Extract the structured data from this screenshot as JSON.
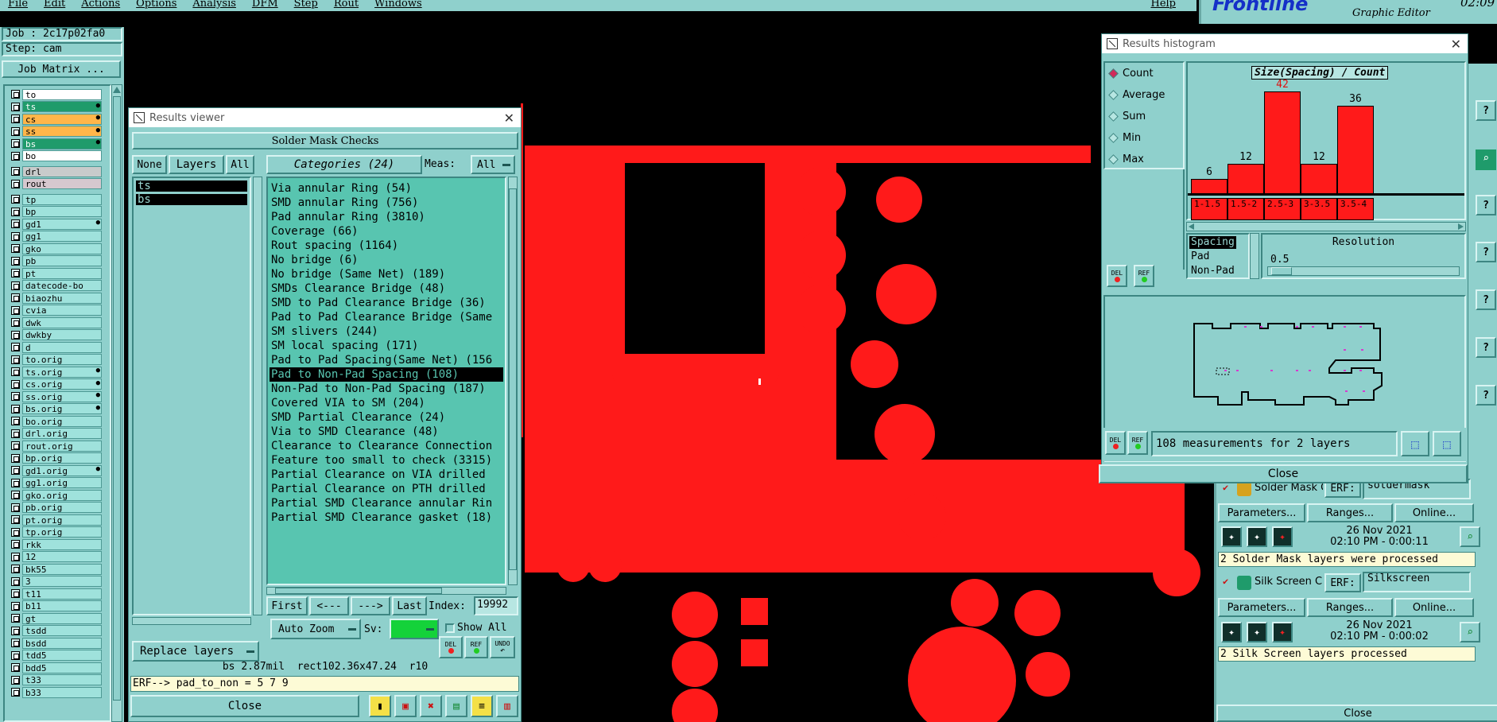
{
  "menu": {
    "items": [
      "File",
      "Edit",
      "Actions",
      "Options",
      "Analysis",
      "DFM",
      "Step",
      "Rout",
      "Windows"
    ],
    "help": "Help"
  },
  "brand": {
    "logo": "Frontline",
    "subtitle": "Graphic Editor",
    "clock": "02:09"
  },
  "job": {
    "job_label": "Job : 2c17p02fa0",
    "step_label": "Step: cam",
    "matrix_button": "Job Matrix ..."
  },
  "layers": [
    {
      "name": "to",
      "color": "#ffffff"
    },
    {
      "name": "ts",
      "color": "#1f9b6b"
    },
    {
      "name": "cs",
      "color": "#ffb64a"
    },
    {
      "name": "ss",
      "color": "#ffb64a"
    },
    {
      "name": "bs",
      "color": "#1f9b6b"
    },
    {
      "name": "bo",
      "color": "#ffffff"
    },
    {
      "name": "drl",
      "color": "#c8cbcb"
    },
    {
      "name": "rout",
      "color": "#d6c8cf"
    },
    {
      "name": "tp",
      "color": "#9fe2dc"
    },
    {
      "name": "bp",
      "color": "#9fe2dc"
    },
    {
      "name": "gd1",
      "color": "#9fe2dc"
    },
    {
      "name": "gg1",
      "color": "#9fe2dc"
    },
    {
      "name": "gko",
      "color": "#9fe2dc"
    },
    {
      "name": "pb",
      "color": "#9fe2dc"
    },
    {
      "name": "pt",
      "color": "#9fe2dc"
    },
    {
      "name": "datecode-bo",
      "color": "#9fe2dc"
    },
    {
      "name": "biaozhu",
      "color": "#9fe2dc"
    },
    {
      "name": "cvia",
      "color": "#9fe2dc"
    },
    {
      "name": "dwk",
      "color": "#9fe2dc"
    },
    {
      "name": "dwkby",
      "color": "#9fe2dc"
    },
    {
      "name": "d",
      "color": "#9fe2dc"
    },
    {
      "name": "to.orig",
      "color": "#9fe2dc"
    },
    {
      "name": "ts.orig",
      "color": "#9fe2dc"
    },
    {
      "name": "cs.orig",
      "color": "#9fe2dc"
    },
    {
      "name": "ss.orig",
      "color": "#9fe2dc"
    },
    {
      "name": "bs.orig",
      "color": "#9fe2dc"
    },
    {
      "name": "bo.orig",
      "color": "#9fe2dc"
    },
    {
      "name": "drl.orig",
      "color": "#9fe2dc"
    },
    {
      "name": "rout.orig",
      "color": "#9fe2dc"
    },
    {
      "name": "bp.orig",
      "color": "#9fe2dc"
    },
    {
      "name": "gd1.orig",
      "color": "#9fe2dc"
    },
    {
      "name": "gg1.orig",
      "color": "#9fe2dc"
    },
    {
      "name": "gko.orig",
      "color": "#9fe2dc"
    },
    {
      "name": "pb.orig",
      "color": "#9fe2dc"
    },
    {
      "name": "pt.orig",
      "color": "#9fe2dc"
    },
    {
      "name": "tp.orig",
      "color": "#9fe2dc"
    },
    {
      "name": "rkk",
      "color": "#9fe2dc"
    },
    {
      "name": "12",
      "color": "#9fe2dc"
    },
    {
      "name": "bk55",
      "color": "#9fe2dc"
    },
    {
      "name": "3",
      "color": "#9fe2dc"
    },
    {
      "name": "t11",
      "color": "#9fe2dc"
    },
    {
      "name": "b11",
      "color": "#9fe2dc"
    },
    {
      "name": "gt",
      "color": "#9fe2dc"
    },
    {
      "name": "tsdd",
      "color": "#9fe2dc"
    },
    {
      "name": "bsdd",
      "color": "#9fe2dc"
    },
    {
      "name": "tdd5",
      "color": "#9fe2dc"
    },
    {
      "name": "bdd5",
      "color": "#9fe2dc"
    },
    {
      "name": "t33",
      "color": "#9fe2dc"
    },
    {
      "name": "b33",
      "color": "#9fe2dc"
    }
  ],
  "viewer": {
    "title": "Results viewer",
    "section": "Solder Mask Checks",
    "none_btn": "None",
    "layers_btn": "Layers",
    "all_btn": "All",
    "categories_btn": "Categories (24)",
    "meas_label": "Meas:",
    "meas_value": "All",
    "layer_list": [
      "ts",
      "bs"
    ],
    "categories": [
      "Via annular Ring (54)",
      "SMD annular Ring (756)",
      "Pad annular Ring (3810)",
      "Coverage (66)",
      "Rout spacing (1164)",
      "No bridge (6)",
      "No bridge (Same Net) (189)",
      "SMDs Clearance Bridge (48)",
      "SMD to Pad Clearance Bridge (36)",
      "Pad to Pad Clearance Bridge (Same",
      "SM slivers (244)",
      "SM local spacing (171)",
      "Pad to Pad Spacing(Same Net) (156",
      "Pad to Non-Pad Spacing (108)",
      "Non-Pad to Non-Pad Spacing (187)",
      "Covered VIA to SM (204)",
      "SMD Partial Clearance (24)",
      "Via to SMD Clearance (48)",
      "Clearance to Clearance Connection",
      "Feature too small to check (3315)",
      "Partial Clearance on VIA drilled",
      "Partial Clearance on PTH drilled",
      "Partial SMD Clearance annular Rin",
      "Partial SMD Clearance gasket (18)"
    ],
    "selected_index": 13,
    "first_btn": "First",
    "prev_btn": "<---",
    "next_btn": "--->",
    "last_btn": "Last",
    "index_label": "Index:",
    "index_value": "19992",
    "auto_zoom": "Auto Zoom",
    "sv_label": "Sv:",
    "show_all": "Show All",
    "replace_layers": "Replace layers",
    "del_label": "DEL",
    "ref_label": "REF",
    "undo_label": "UNDO",
    "status": "bs 2.87mil  rect102.36x47.24  r10",
    "erf_line": "ERF--> pad_to_non = 5 7 9",
    "close_btn": "Close"
  },
  "histogram": {
    "title": "Results histogram",
    "options": [
      "Count",
      "Average",
      "Sum",
      "Min",
      "Max"
    ],
    "selected_option": "Count",
    "types": [
      "Spacing",
      "Pad",
      "Non-Pad"
    ],
    "selected_type": "Spacing",
    "resolution_label": "Resolution",
    "resolution_value": "0.5",
    "footer": "108 measurements for 2 layers",
    "close_btn": "Close",
    "del_label": "DEL",
    "ref_label": "REF"
  },
  "chart_data": {
    "type": "bar",
    "title": "Size(Spacing) / Count",
    "categories": [
      "1-1.5",
      "1.5-2",
      "2.5-3",
      "3-3.5",
      "3.5-4"
    ],
    "values": [
      6,
      12,
      42,
      12,
      36
    ],
    "ylim": [
      0,
      42
    ],
    "grid": false,
    "bar_color": "#ff1a1a"
  },
  "checks": {
    "solder_title": "Solder Mask Ch",
    "erf_label": "ERF:",
    "solder_erf": "soldermask",
    "params_btn": "Parameters...",
    "ranges_btn": "Ranges...",
    "online_btn": "Online...",
    "solder_date": "26 Nov 2021",
    "solder_time": "02:10 PM - 0:00:11",
    "solder_msg": "2 Solder Mask layers were processed",
    "silk_title": "Silk Screen Che",
    "silk_erf": "Silkscreen",
    "silk_date": "26 Nov 2021",
    "silk_time": "02:10 PM - 0:00:02",
    "silk_msg": "2 Silk Screen layers processed",
    "close_btn": "Close"
  }
}
